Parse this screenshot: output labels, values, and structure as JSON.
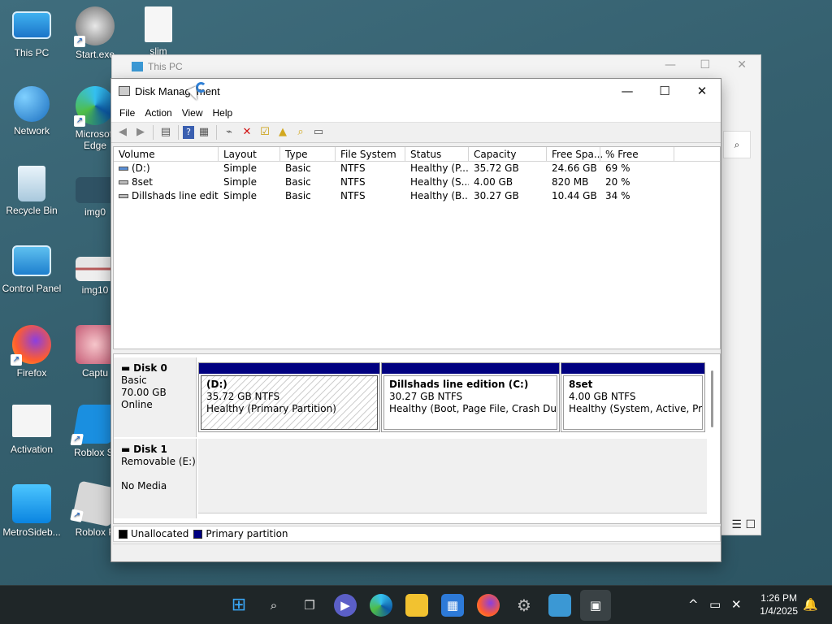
{
  "desktop": {
    "icons": [
      {
        "label": "This PC"
      },
      {
        "label": "Start.exe"
      },
      {
        "label": "slim"
      },
      {
        "label": "Network"
      },
      {
        "label": "Microsoft Edge"
      },
      {
        "label": "Recycle Bin"
      },
      {
        "label": "img0"
      },
      {
        "label": "Control Panel"
      },
      {
        "label": "img10"
      },
      {
        "label": "Firefox"
      },
      {
        "label": "Captu"
      },
      {
        "label": "Activation"
      },
      {
        "label": "Roblox St"
      },
      {
        "label": "MetroSideb..."
      },
      {
        "label": "Roblox P"
      }
    ]
  },
  "back_window": {
    "title": "This PC"
  },
  "disk_management": {
    "title": "Disk Management",
    "window_controls": {
      "minimize": "—",
      "maximize": "☐",
      "close": "✕"
    },
    "menu": [
      "File",
      "Action",
      "View",
      "Help"
    ],
    "columns": [
      "Volume",
      "Layout",
      "Type",
      "File System",
      "Status",
      "Capacity",
      "Free Spa...",
      "% Free"
    ],
    "volumes": [
      {
        "volume": "(D:)",
        "layout": "Simple",
        "type": "Basic",
        "fs": "NTFS",
        "status": "Healthy (P...",
        "capacity": "35.72 GB",
        "free": "24.66 GB",
        "pct": "69 %"
      },
      {
        "volume": "8set",
        "layout": "Simple",
        "type": "Basic",
        "fs": "NTFS",
        "status": "Healthy (S...",
        "capacity": "4.00 GB",
        "free": "820 MB",
        "pct": "20 %"
      },
      {
        "volume": "Dillshads line editi...",
        "layout": "Simple",
        "type": "Basic",
        "fs": "NTFS",
        "status": "Healthy (B...",
        "capacity": "30.27 GB",
        "free": "10.44 GB",
        "pct": "34 %"
      }
    ],
    "disks": [
      {
        "name": "Disk 0",
        "type": "Basic",
        "size": "70.00 GB",
        "state": "Online",
        "partitions": [
          {
            "name": "(D:)",
            "size": "35.72 GB NTFS",
            "status": "Healthy (Primary Partition)"
          },
          {
            "name": "Dillshads line edition  (C:)",
            "size": "30.27 GB NTFS",
            "status": "Healthy (Boot, Page File, Crash Dump,"
          },
          {
            "name": "8set",
            "size": "4.00 GB NTFS",
            "status": "Healthy (System, Active, Prima"
          }
        ]
      },
      {
        "name": "Disk 1",
        "type": "Removable (E:)",
        "state": "No Media"
      }
    ],
    "legend": [
      {
        "label": "Unallocated",
        "color": "#000000"
      },
      {
        "label": "Primary partition",
        "color": "#000080"
      }
    ]
  },
  "taskbar": {
    "time": "1:26 PM",
    "date": "1/4/2025"
  }
}
